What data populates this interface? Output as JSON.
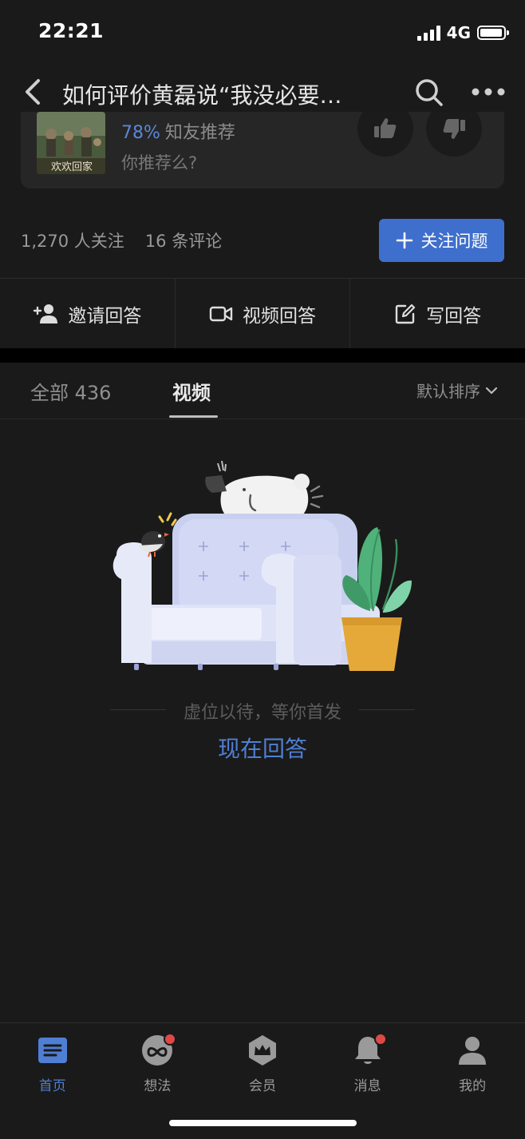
{
  "status_bar": {
    "time": "22:21",
    "network": "4G"
  },
  "nav": {
    "title": "如何评价黄磊说“我没必要…"
  },
  "recommend_card": {
    "percent": "78%",
    "percent_label": "知友推荐",
    "question": "你推荐么?",
    "thumbnail_caption": "欢欢回家"
  },
  "stats": {
    "followers": "1,270 人关注",
    "comments": "16 条评论"
  },
  "follow_button": {
    "label": "关注问题"
  },
  "actions": [
    {
      "label": "邀请回答",
      "icon": "invite-user-icon"
    },
    {
      "label": "视频回答",
      "icon": "video-camera-icon"
    },
    {
      "label": "写回答",
      "icon": "edit-icon"
    }
  ],
  "tabs": {
    "all": "全部 436",
    "video": "视频",
    "sort": "默认排序"
  },
  "empty_state": {
    "text": "虚位以待，等你首发",
    "cta": "现在回答"
  },
  "bottom_nav": [
    {
      "label": "首页",
      "icon": "home-icon",
      "active": true
    },
    {
      "label": "想法",
      "icon": "ideas-icon",
      "badge": true
    },
    {
      "label": "会员",
      "icon": "vip-crown-icon"
    },
    {
      "label": "消息",
      "icon": "bell-icon",
      "badge": true
    },
    {
      "label": "我的",
      "icon": "profile-icon"
    }
  ],
  "colors": {
    "accent": "#4f7fd4",
    "button": "#3f6fcc",
    "background": "#1a1a1a",
    "badge": "#e04848"
  }
}
